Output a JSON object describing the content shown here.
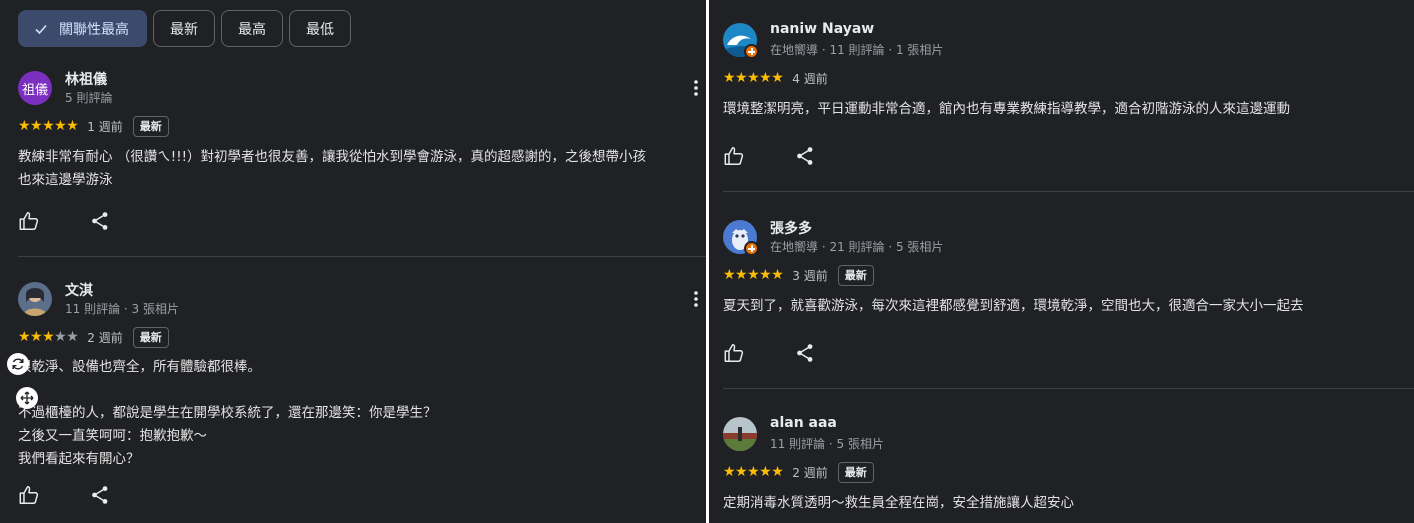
{
  "filters": [
    {
      "label": "關聯性最高",
      "selected": true
    },
    {
      "label": "最新",
      "selected": false
    },
    {
      "label": "最高",
      "selected": false
    },
    {
      "label": "最低",
      "selected": false
    }
  ],
  "reviews_left": [
    {
      "avatar_text": "祖儀",
      "name": "林祖儀",
      "meta": "5 則評論",
      "rating": 5,
      "stars": "★★★★★",
      "when": "1 週前",
      "badge": "最新",
      "text": "教練非常有耐心 （很讚ㄟ!!!）對初學者也很友善，讓我從怕水到學會游泳，真的超感謝的，之後想帶小孩\n也來這邊學游泳"
    },
    {
      "avatar_icon": "user-photo",
      "name": "文淇",
      "meta": "11 則評論 · 3 張相片",
      "rating": 3,
      "stars_on": "★★★",
      "stars_off": "★★",
      "when": "2 週前",
      "badge": "最新",
      "text": "很乾淨、設備也齊全，所有體驗都很棒。\n\n不過櫃檯的人，都說是學生在開學校系統了，還在那邊笑：你是學生？\n之後又一直笑呵呵：抱歉抱歉～\n我們看起來有開心？"
    }
  ],
  "reviews_right": [
    {
      "avatar_icon": "wave-avatar",
      "name": "naniw Nayaw",
      "meta": "在地嚮導 · 11 則評論 · 1 張相片",
      "rating": 5,
      "stars": "★★★★★",
      "when": "4 週前",
      "text": "環境整潔明亮，平日運動非常合適，館內也有專業教練指導教學，適合初階游泳的人來這邊運動"
    },
    {
      "avatar_icon": "owl-avatar",
      "name": "張多多",
      "meta": "在地嚮導 · 21 則評論 · 5 張相片",
      "rating": 5,
      "stars": "★★★★★",
      "when": "3 週前",
      "badge": "最新",
      "text": "夏天到了，就喜歡游泳，每次來這裡都感覺到舒適，環境乾淨，空間也大，很適合一家大小一起去"
    },
    {
      "avatar_icon": "outdoor-photo",
      "name": "alan aaa",
      "meta": "11 則評論 · 5 張相片",
      "rating": 5,
      "stars": "★★★★★",
      "when": "2 週前",
      "badge": "最新",
      "text": "定期消毒水質透明～救生員全程在崗，安全措施讓人超安心"
    }
  ],
  "colors": {
    "background": "#202124",
    "star": "#fbbc04",
    "selected_chip": "#3c4a6b",
    "guide_badge": "#e8710a"
  }
}
